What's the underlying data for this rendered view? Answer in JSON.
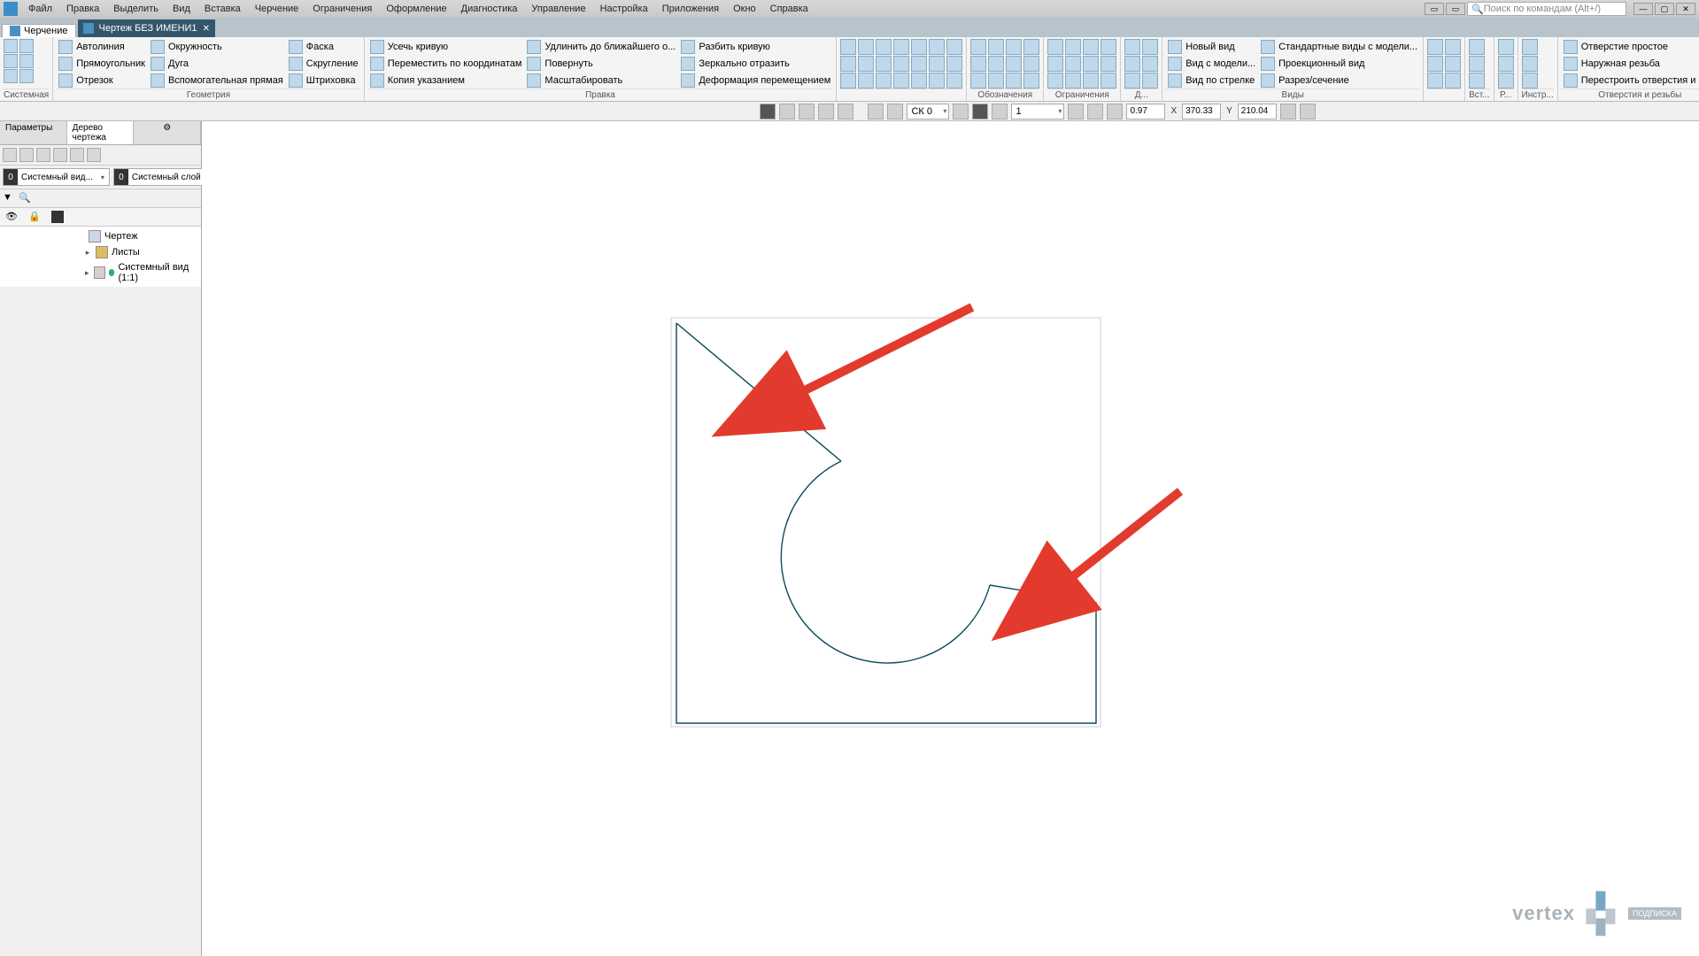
{
  "menu": {
    "items": [
      "Файл",
      "Правка",
      "Выделить",
      "Вид",
      "Вставка",
      "Черчение",
      "Ограничения",
      "Оформление",
      "Диагностика",
      "Управление",
      "Настройка",
      "Приложения",
      "Окно",
      "Справка"
    ]
  },
  "search": {
    "placeholder": "Поиск по командам (Alt+/)"
  },
  "doc_tab": "Чертеж БЕЗ ИМЕНИ1",
  "mode_tab": "Черчение",
  "ribbon": {
    "groups": [
      {
        "label": "Системная",
        "cols": [
          [
            "",
            "",
            ""
          ],
          [
            "",
            "",
            ""
          ]
        ],
        "texted": []
      },
      {
        "label": "Геометрия",
        "texted": [
          [
            "Автолиния",
            "Окружность",
            "Фаска"
          ],
          [
            "Прямоугольник",
            "Дуга",
            "Скругление"
          ],
          [
            "Отрезок",
            "Вспомогатель­ная прямая",
            "Штриховка"
          ]
        ]
      },
      {
        "label": "Правка",
        "texted": [
          [
            "Усечь кривую",
            "Удлинить до ближайшего о...",
            "Разбить кривую"
          ],
          [
            "Переместить по координатам",
            "Повернуть",
            "Зеркально отразить"
          ],
          [
            "Копия указанием",
            "Масштабировать",
            "Деформация перемещением"
          ]
        ]
      },
      {
        "label": "",
        "iconcols": 7,
        "iconrows": 3
      },
      {
        "label": "Обозначения",
        "iconcols": 4,
        "iconrows": 3
      },
      {
        "label": "Ограничения",
        "iconcols": 4,
        "iconrows": 3
      },
      {
        "label": "Д...",
        "iconcols": 2,
        "iconrows": 3
      },
      {
        "label": "Виды",
        "texted": [
          [
            "Новый вид",
            "Стандартные виды с модели..."
          ],
          [
            "Вид с модели...",
            "Проекционный вид"
          ],
          [
            "Вид по стрелке",
            "Разрез/сечение"
          ]
        ]
      },
      {
        "label": "",
        "iconcols": 2,
        "iconrows": 3
      },
      {
        "label": "Вст...",
        "iconcols": 1,
        "iconrows": 3
      },
      {
        "label": "Р...",
        "iconcols": 1,
        "iconrows": 3
      },
      {
        "label": "Инстр...",
        "iconcols": 1,
        "iconrows": 3
      },
      {
        "label": "Отверстия и резьбы",
        "texted": [
          [
            "Отверстие простое"
          ],
          [
            "Наружная резьба"
          ],
          [
            "Перестроить отверстия и из..."
          ]
        ]
      }
    ]
  },
  "statusbar": {
    "cs": "СК 0",
    "scale": "1",
    "zoom": "0.97",
    "xlabel": "X",
    "x": "370.33",
    "ylabel": "Y",
    "y": "210.04"
  },
  "sidebar": {
    "tab1": "Параметры",
    "tab2": "Дерево чертежа",
    "view_num": "0",
    "view_name": "Системный вид...",
    "layer_num": "0",
    "layer_name": "Системный слой",
    "tree": {
      "root": "Чертеж",
      "sheets": "Листы",
      "sysview": "Системный вид (1:1)"
    }
  },
  "watermark": {
    "brand": "vertex",
    "badge": "ПОДПИСКА"
  }
}
